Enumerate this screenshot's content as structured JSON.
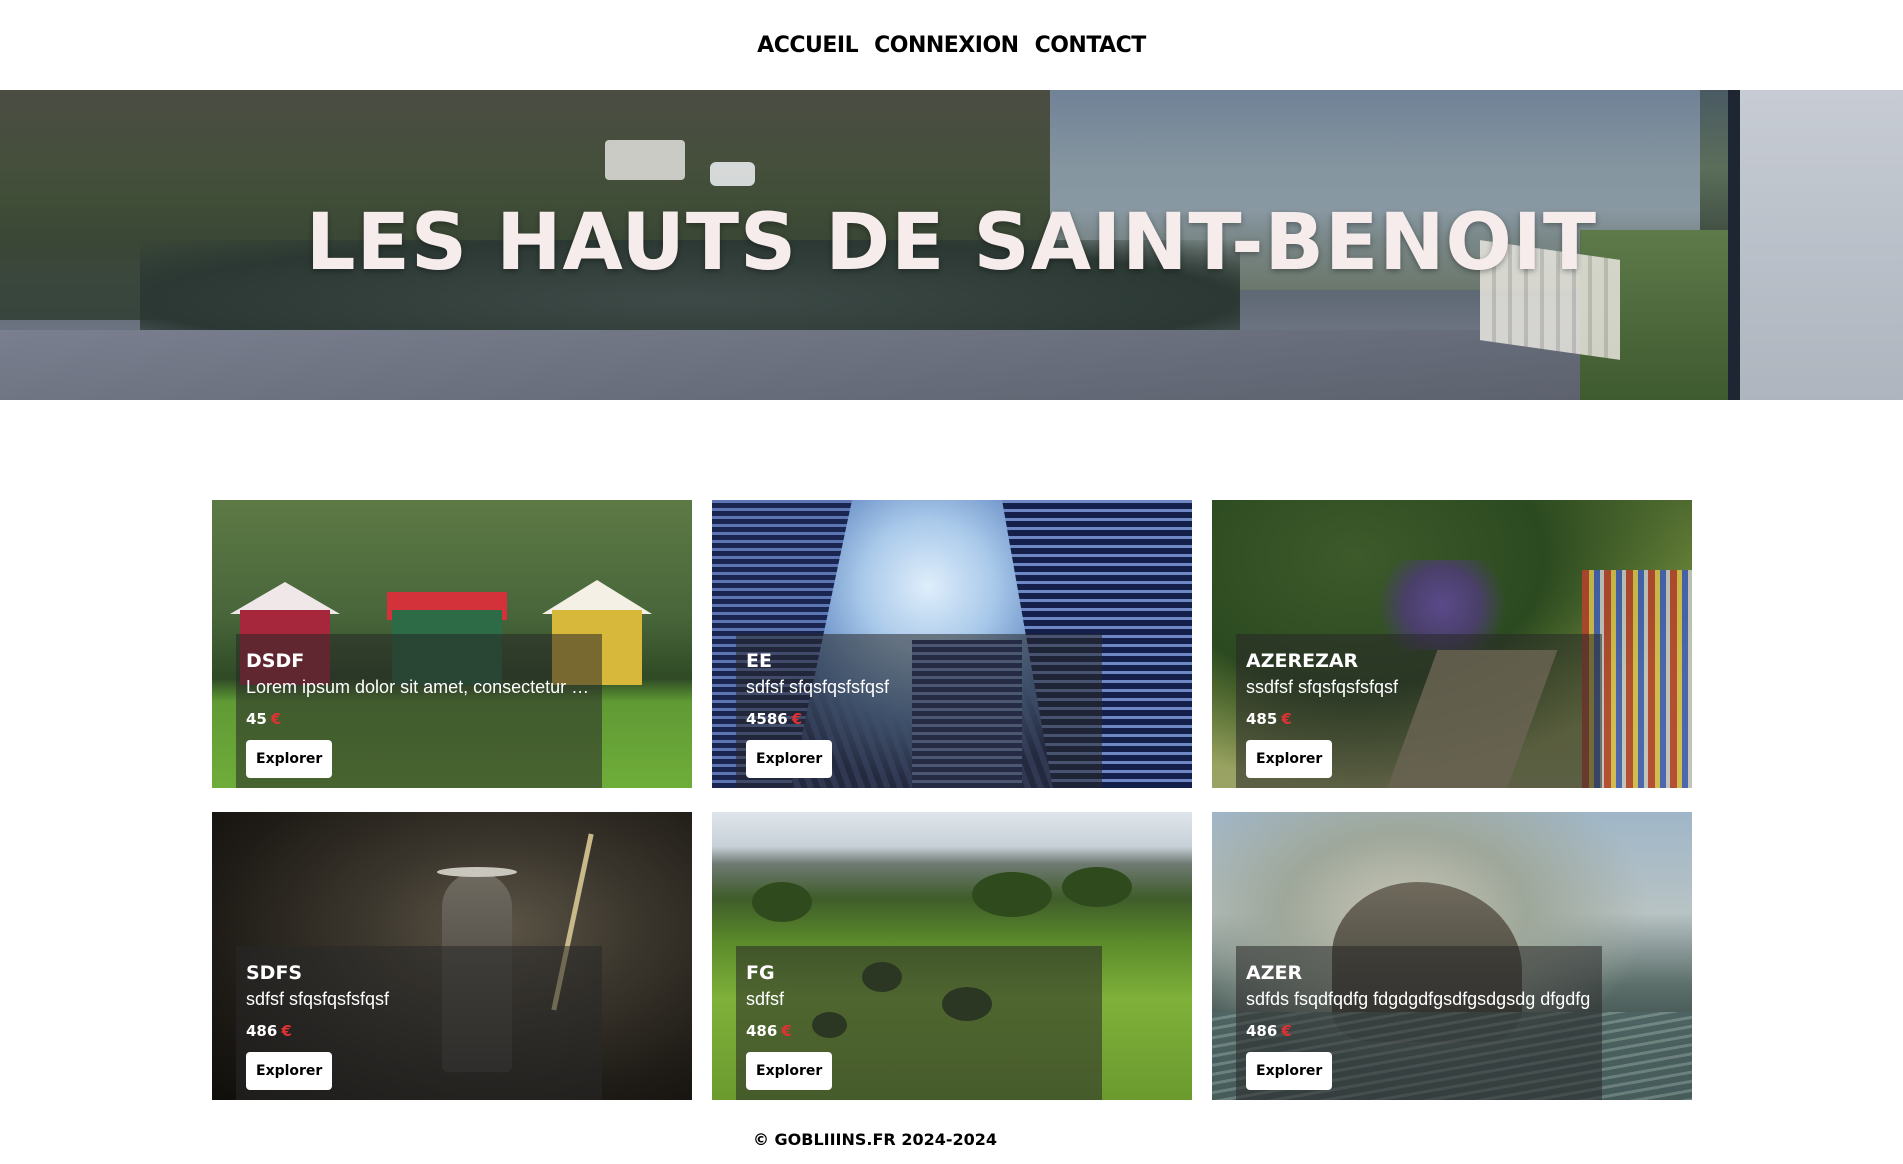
{
  "nav": {
    "items": [
      {
        "label": "ACCUEIL"
      },
      {
        "label": "CONNEXION"
      },
      {
        "label": "CONTACT"
      }
    ]
  },
  "hero": {
    "title": "LES HAUTS DE SAINT-BENOIT"
  },
  "cards": [
    {
      "title": "DSDF",
      "description": "Lorem ipsum dolor sit amet, consectetur adipiscing elit",
      "price": "45",
      "currency": "€",
      "button": "Explorer"
    },
    {
      "title": "EE",
      "description": "sdfsf sfqsfqsfsfqsf",
      "price": "4586",
      "currency": "€",
      "button": "Explorer"
    },
    {
      "title": "AZEREZAR",
      "description": "ssdfsf sfqsfqsfsfqsf",
      "price": "485",
      "currency": "€",
      "button": "Explorer"
    },
    {
      "title": "SDFS",
      "description": "sdfsf sfqsfqsfsfqsf",
      "price": "486",
      "currency": "€",
      "button": "Explorer"
    },
    {
      "title": "FG",
      "description": "sdfsf",
      "price": "486",
      "currency": "€",
      "button": "Explorer"
    },
    {
      "title": "AZER",
      "description": "sdfds fsqdfqdfg fdgdgdfgsdfgsdgsdg dfgdfg",
      "price": "486",
      "currency": "€",
      "button": "Explorer"
    }
  ],
  "footer": {
    "text": "© GOBLIIINS.FR 2024-2024"
  },
  "colors": {
    "currency": "#e03232",
    "title_text": "#f7ecec"
  }
}
